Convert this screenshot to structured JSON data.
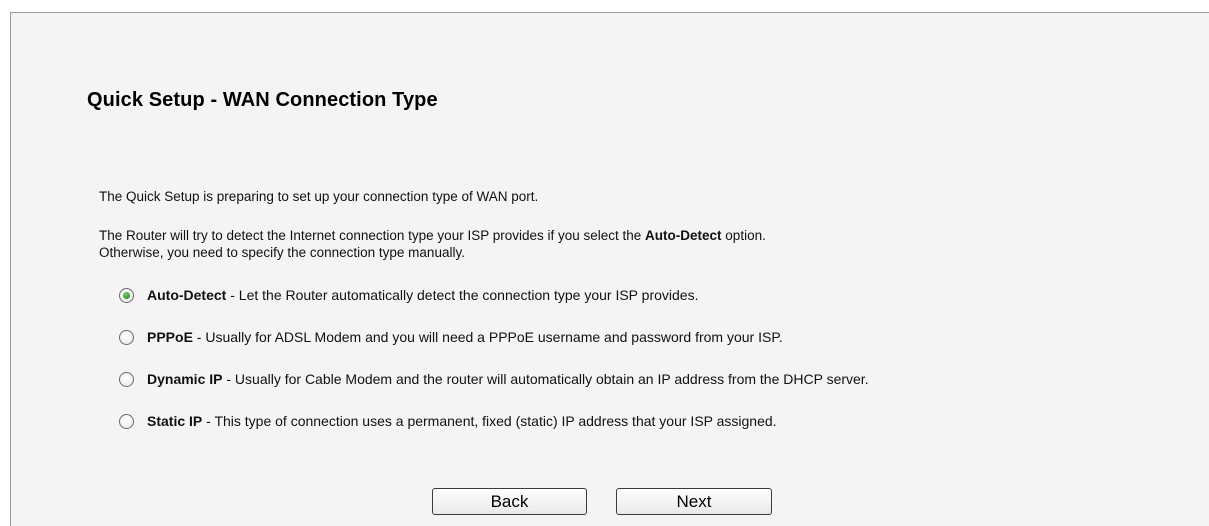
{
  "page": {
    "title": "Quick Setup - WAN Connection Type",
    "intro": "The Quick Setup is preparing to set up your connection type of WAN port.",
    "detect_text_before": "The Router will try to detect the Internet connection type your ISP provides if you select the ",
    "detect_bold": "Auto-Detect",
    "detect_text_after": " option.",
    "detect_line2": "Otherwise, you need to specify the connection type manually."
  },
  "options": [
    {
      "name": "Auto-Detect",
      "description": " - Let the Router automatically detect the connection type your ISP provides.",
      "checked": true
    },
    {
      "name": "PPPoE",
      "description": " - Usually for ADSL Modem and you will need a PPPoE username and password from your ISP.",
      "checked": false
    },
    {
      "name": "Dynamic IP",
      "description": " - Usually for Cable Modem and the router will automatically obtain an IP address from the DHCP server.",
      "checked": false
    },
    {
      "name": "Static IP",
      "description": " - This type of connection uses a permanent, fixed (static) IP address that your ISP assigned.",
      "checked": false
    }
  ],
  "buttons": {
    "back": "Back",
    "next": "Next"
  },
  "colors": {
    "panel_background": "#f4f4f4",
    "panel_border": "#9a9a9a",
    "radio_selected": "#3b9b38"
  }
}
